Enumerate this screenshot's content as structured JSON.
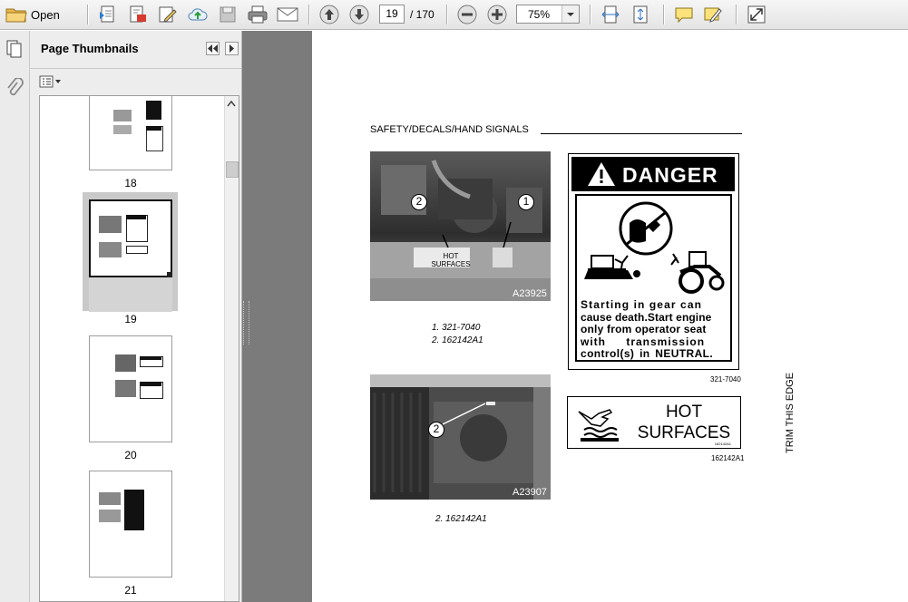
{
  "toolbar": {
    "open_label": "Open",
    "current_page": "19",
    "page_total": "/ 170",
    "zoom": "75%"
  },
  "sidebar": {
    "title": "Page Thumbnails",
    "thumbnails": [
      {
        "label": "18"
      },
      {
        "label": "19",
        "selected": true
      },
      {
        "label": "20"
      },
      {
        "label": "21"
      }
    ]
  },
  "document": {
    "header": "SAFETY/DECALS/HAND SIGNALS",
    "photo1": {
      "code": "A23925",
      "callout_1": "1",
      "callout_2": "2",
      "hot_text_line1": "HOT",
      "hot_text_line2": "SURFACES"
    },
    "captions_top": [
      "1. 321-7040",
      "2. 162142A1"
    ],
    "photo2": {
      "code": "A23907",
      "callout_2": "2"
    },
    "caption_bottom": "2. 162142A1",
    "danger_decal": {
      "heading": "DANGER",
      "lines": [
        "Starting in gear can",
        "cause death.Start engine",
        "only from operator seat",
        "with transmission",
        "control(s) in NEUTRAL."
      ],
      "number": "321-7040"
    },
    "hot_decal": {
      "line1": "HOT",
      "line2": "SURFACES",
      "small_code": "162142A1",
      "number": "162142A1"
    },
    "trim_text": "TRIM THIS EDGE"
  },
  "colors": {
    "toolbar_bg": "#ececec",
    "panel_bg": "#ededed",
    "viewer_gutter": "#7b7b7b",
    "page_bg": "#ffffff"
  }
}
